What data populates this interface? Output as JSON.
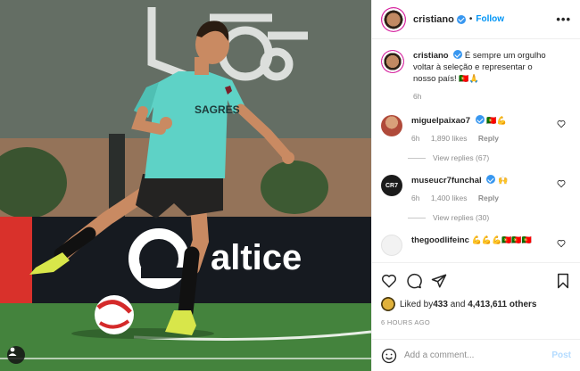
{
  "colors": {
    "accent": "#0095f6",
    "verified": "#3897f0",
    "muted": "#8e8e8e",
    "pitch": "#3f7d3a",
    "kit": "#5ed2c6"
  },
  "post": {
    "username": "cristiano",
    "dot": "•",
    "follow_label": "Follow",
    "more_label": "•••",
    "caption_username": "cristiano",
    "caption_text": "É sempre um orgulho voltar à seleção e representar o nosso país!",
    "caption_emoji": "🇵🇹🙏",
    "caption_age": "6h"
  },
  "photo": {
    "board_text": "altice",
    "shirt_text": "SAGRES",
    "tag_icon": "user-icon"
  },
  "comments": [
    {
      "username": "miguelpaixao7",
      "text_emoji": "🇵🇹💪",
      "age": "6h",
      "likes": "1,890 likes",
      "reply": "Reply",
      "view_replies": "View replies (67)",
      "avatar_color": "#b04a3a"
    },
    {
      "username": "museucr7funchal",
      "text_emoji": "🙌",
      "age": "6h",
      "likes": "1,400 likes",
      "reply": "Reply",
      "view_replies": "View replies (30)",
      "avatar_color": "#1b1b1b",
      "avatar_text": "CR7"
    },
    {
      "username": "thegoodlifeinc",
      "text_emoji": "💪💪💪🇵🇹🇵🇹🇵🇹",
      "avatar_color": "#f2f2f2"
    }
  ],
  "actions": {
    "icons": [
      "heart-icon",
      "comment-icon",
      "share-icon",
      "bookmark-icon"
    ],
    "liked_by_prefix": "Liked by ",
    "liked_by_user": "433",
    "liked_by_mid": " and ",
    "liked_by_count": "4,413,611 others",
    "time_ago": "6 HOURS AGO"
  },
  "composer": {
    "placeholder": "Add a comment...",
    "post_label": "Post"
  }
}
